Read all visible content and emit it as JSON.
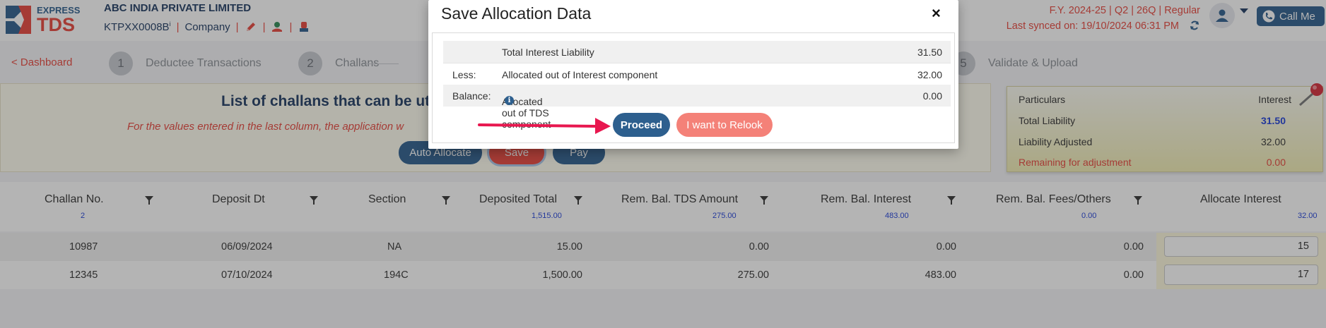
{
  "header": {
    "logo_top": "EXPRESS",
    "logo_bottom": "TDS",
    "company": "ABC INDIA PRIVATE LIMITED",
    "tan": "KTPXX0008B",
    "tan_info": "i",
    "separator": "|",
    "entity_type": "Company",
    "fy_line": "F.Y. 2024-25  |  Q2  |  26Q  |  Regular",
    "synced": "Last synced on: 19/10/2024 06:31 PM",
    "call_me": "Call Me"
  },
  "stepper": {
    "back": "< Dashboard",
    "steps": [
      {
        "num": "1",
        "label": "Deductee Transactions"
      },
      {
        "num": "2",
        "label": "Challans"
      },
      {
        "num": "5",
        "label": "Validate & Upload"
      }
    ]
  },
  "banner": {
    "title": "List of challans that can be ut",
    "subtitle": "For the values entered in the last column, the application w",
    "auto_allocate": "Auto Allocate",
    "save": "Save",
    "pay": "Pay"
  },
  "summary": {
    "header_left": "Particulars",
    "header_right": "Interest",
    "rows": [
      {
        "label": "Total Liability",
        "value": "31.50"
      },
      {
        "label": "Liability Adjusted",
        "value": "32.00"
      },
      {
        "label": "Remaining for adjustment",
        "value": "0.00"
      }
    ]
  },
  "table": {
    "columns": [
      {
        "label": "Challan No.",
        "sub": "2"
      },
      {
        "label": "Deposit Dt",
        "sub": ""
      },
      {
        "label": "Section",
        "sub": ""
      },
      {
        "label": "Deposited Total",
        "sub": "1,515.00"
      },
      {
        "label": "Rem. Bal. TDS Amount",
        "sub": "275.00"
      },
      {
        "label": "Rem. Bal. Interest",
        "sub": "483.00"
      },
      {
        "label": "Rem. Bal. Fees/Others",
        "sub": "0.00"
      },
      {
        "label": "Allocate Interest",
        "sub": "32.00"
      }
    ],
    "rows": [
      {
        "challan": "10987",
        "date": "06/09/2024",
        "section": "NA",
        "deposited": "15.00",
        "tds": "0.00",
        "interest": "0.00",
        "fees": "0.00",
        "allocate": "15"
      },
      {
        "challan": "12345",
        "date": "07/10/2024",
        "section": "194C",
        "deposited": "1,500.00",
        "tds": "275.00",
        "interest": "483.00",
        "fees": "0.00",
        "allocate": "17"
      }
    ]
  },
  "modal": {
    "title": "Save Allocation Data",
    "close": "×",
    "rows": [
      {
        "prefix": "",
        "label": "Total Interest Liability",
        "value": "31.50"
      },
      {
        "prefix": "Less:",
        "label": "Allocated out of Interest component",
        "value": "32.00"
      },
      {
        "prefix": "Balance:",
        "label": "Allocated out of TDS component",
        "value": "0.00"
      }
    ],
    "info_glyph": "i",
    "proceed": "Proceed",
    "relook": "I want to Relook"
  },
  "colors": {
    "brand_blue": "#2d5f8e",
    "brand_red": "#e8453c",
    "arrow": "#e8174f",
    "relook": "#f48178"
  }
}
